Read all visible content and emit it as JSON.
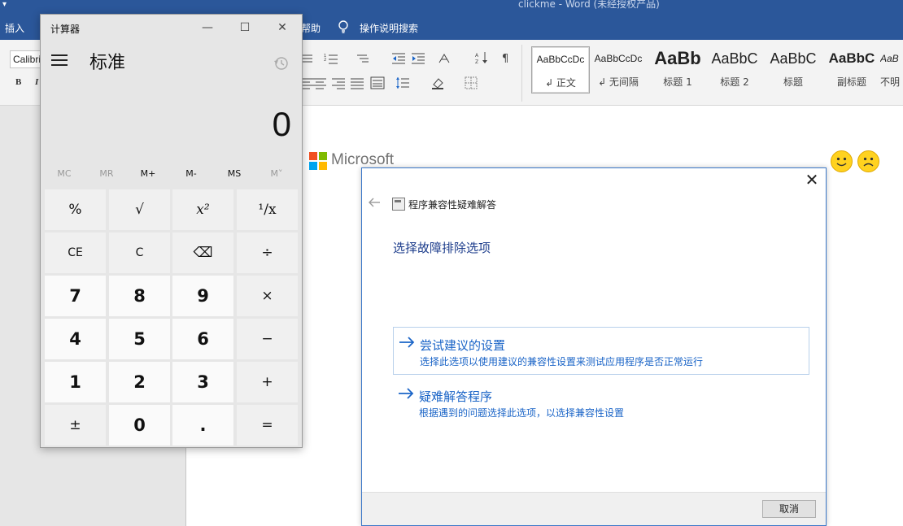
{
  "word": {
    "window_title": "clickme  -  Word (未经授权产品)",
    "menu_tabs": [
      "插入",
      "帮助",
      "操作说明搜索"
    ],
    "font_name": "Calibri",
    "bold_label": "B",
    "italic_label": "I",
    "styles": [
      {
        "sample": "AaBbCcDc",
        "name": "↲ 正文"
      },
      {
        "sample": "AaBbCcDc",
        "name": "↲ 无间隔"
      },
      {
        "sample": "AaBb",
        "name": "标题 1"
      },
      {
        "sample": "AaBbC",
        "name": "标题 2"
      },
      {
        "sample": "AaBbC",
        "name": "标题"
      },
      {
        "sample": "AaBbC",
        "name": "副标题"
      },
      {
        "sample": "AaB",
        "name": "不明"
      }
    ],
    "doc_logo_text": "Microsoft"
  },
  "dialog": {
    "app_title": "程序兼容性疑难解答",
    "heading": "选择故障排除选项",
    "options": [
      {
        "title": "尝试建议的设置",
        "desc": "选择此选项以使用建议的兼容性设置来测试应用程序是否正常运行"
      },
      {
        "title": "疑难解答程序",
        "desc": "根据遇到的问题选择此选项，以选择兼容性设置"
      }
    ],
    "cancel_label": "取消",
    "close_glyph": "✕"
  },
  "calculator": {
    "title": "计算器",
    "mode": "标准",
    "display": "0",
    "memory": [
      "MC",
      "MR",
      "M+",
      "M-",
      "MS",
      "M˅"
    ],
    "keys": [
      [
        "%",
        "√",
        "x²",
        "¹/x"
      ],
      [
        "CE",
        "C",
        "⌫",
        "÷"
      ],
      [
        "7",
        "8",
        "9",
        "×"
      ],
      [
        "4",
        "5",
        "6",
        "−"
      ],
      [
        "1",
        "2",
        "3",
        "+"
      ],
      [
        "±",
        "0",
        ".",
        "="
      ]
    ],
    "minimize_glyph": "—",
    "maximize_glyph": "☐",
    "close_glyph": "✕"
  },
  "colors": {
    "word_blue": "#2b579a",
    "link_blue": "#1a64c7",
    "heading_blue": "#1d3d8c"
  }
}
